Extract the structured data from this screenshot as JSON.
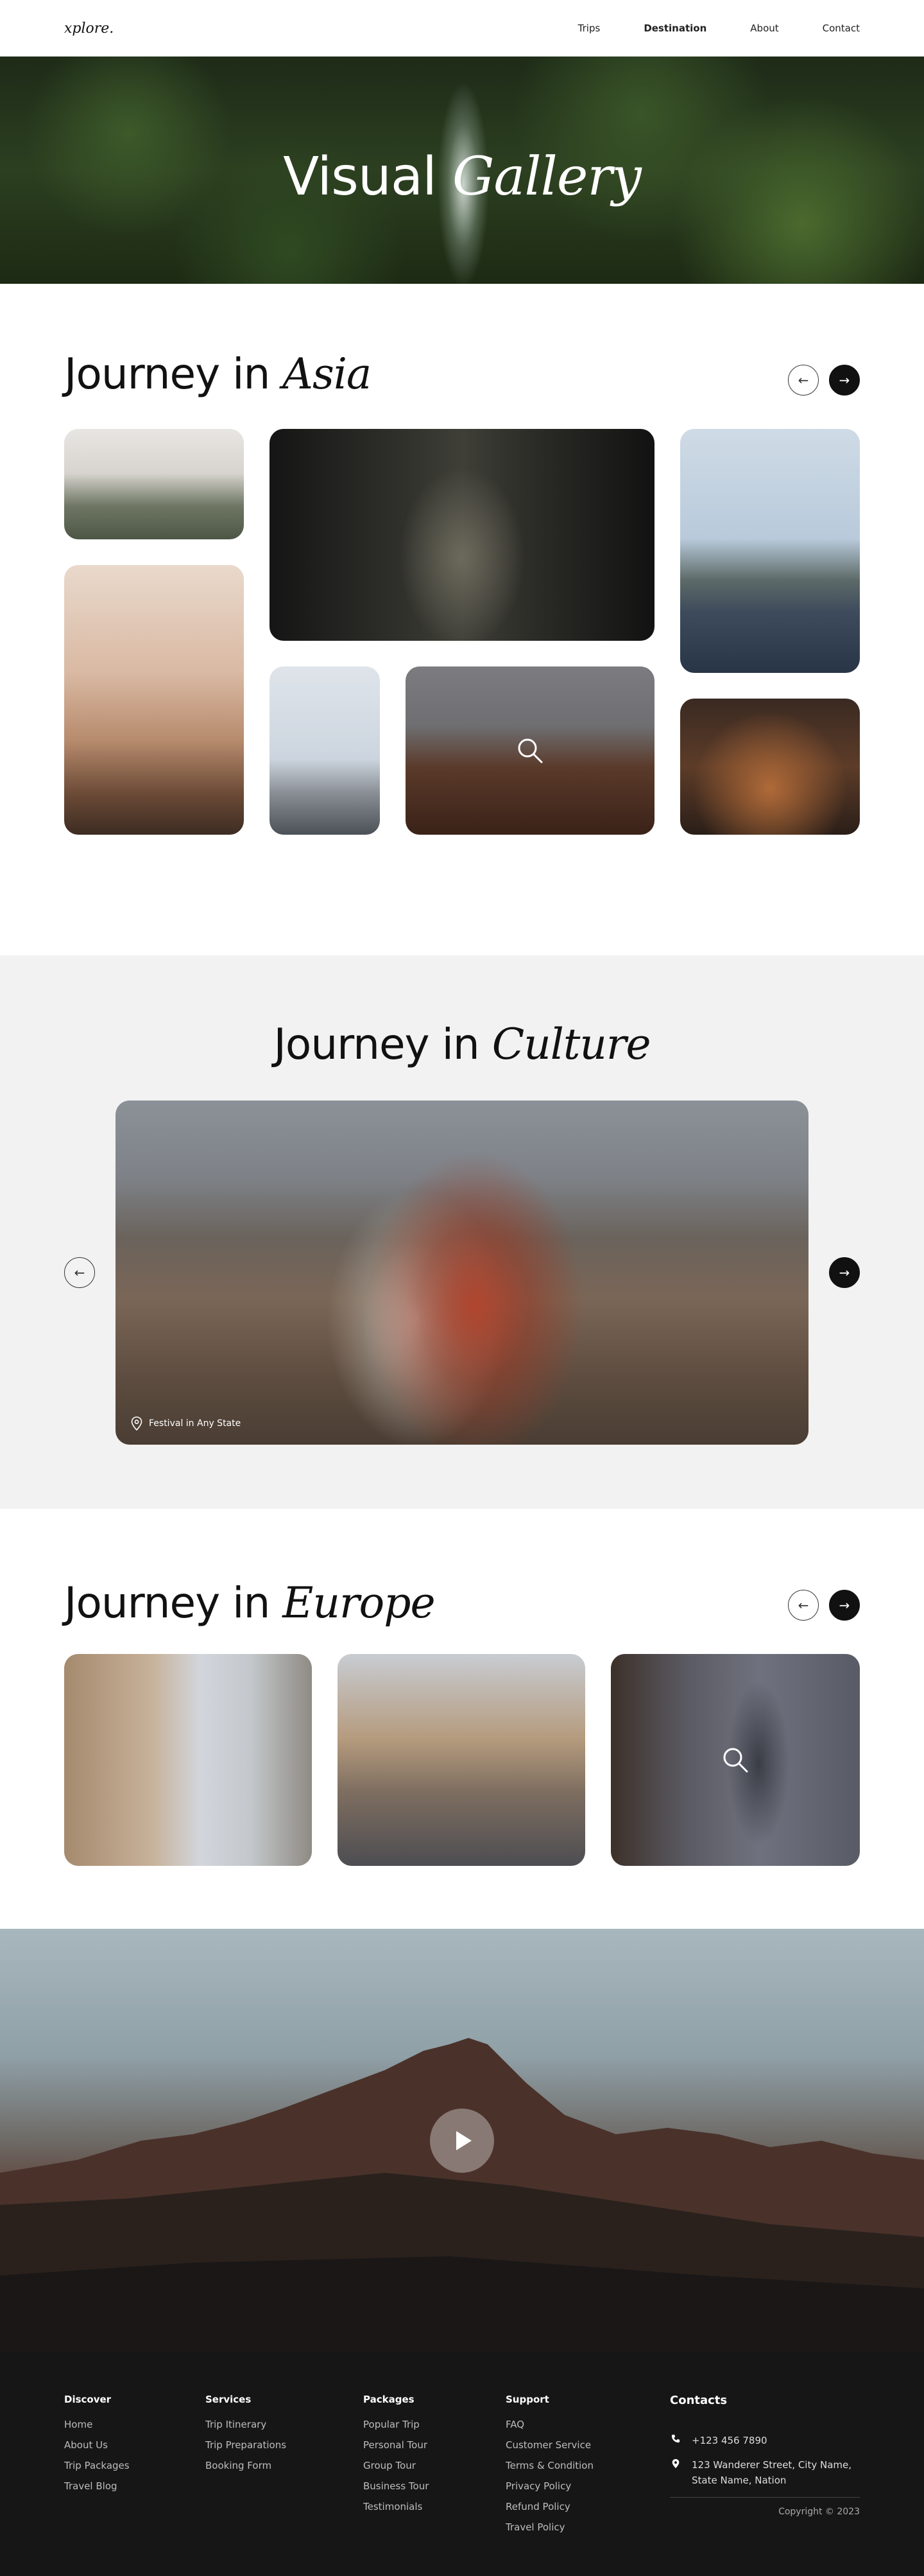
{
  "nav": {
    "logo": "xplore.",
    "links": [
      "Trips",
      "Destination",
      "About",
      "Contact"
    ],
    "active": "Destination"
  },
  "hero": {
    "title_plain": "Visual",
    "title_italic": "Gallery"
  },
  "asia": {
    "title_plain": "Journey in",
    "title_italic": "Asia"
  },
  "culture": {
    "title_plain": "Journey in",
    "title_italic": "Culture",
    "caption": "Festival in Any State"
  },
  "europe": {
    "title_plain": "Journey in",
    "title_italic": "Europe"
  },
  "arrows": {
    "prev": "←",
    "next": "→"
  },
  "footer": {
    "discover": {
      "title": "Discover",
      "links": [
        "Home",
        "About Us",
        "Trip Packages",
        "Travel Blog"
      ]
    },
    "services": {
      "title": "Services",
      "links": [
        "Trip Itinerary",
        "Trip Preparations",
        "Booking Form"
      ]
    },
    "packages": {
      "title": "Packages",
      "links": [
        "Popular Trip",
        "Personal Tour",
        "Group Tour",
        "Business Tour",
        "Testimonials"
      ]
    },
    "support": {
      "title": "Support",
      "links": [
        "FAQ",
        "Customer Service",
        "Terms & Condition",
        "Privacy Policy",
        "Refund Policy",
        "Travel Policy"
      ]
    },
    "contacts": {
      "title": "Contacts",
      "phone": "+123 456 7890",
      "address": "123 Wanderer Street, City Name, State Name, Nation",
      "copyright": "Copyright © 2023"
    }
  },
  "colors": {
    "dark": "#111111",
    "footer_bg": "#161616",
    "culture_bg": "#f2f2f2"
  }
}
